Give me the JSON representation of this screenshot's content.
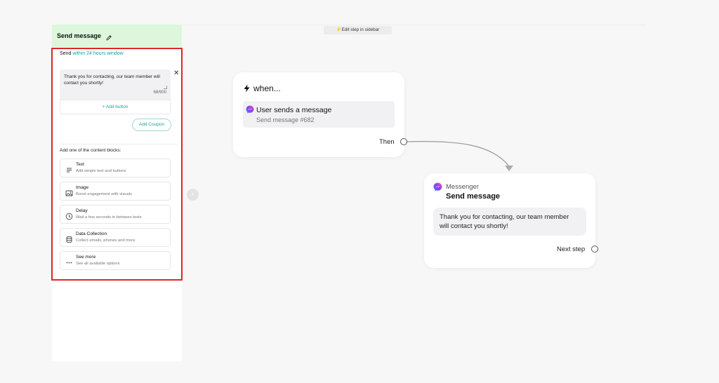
{
  "sidebar": {
    "title": "Send message",
    "send_prefix": "Send",
    "send_window": "within 24 hours window",
    "message_text": "Thank you for contacting, our team member  will contact you shortly!",
    "char_count": "68/900",
    "close_glyph": "✕",
    "add_button_label": "+ Add button",
    "coupon_label": "Add Coupon",
    "blocks_label": "Add one of the content blocks:",
    "blocks": [
      {
        "title": "Text",
        "subtitle": "Add simple text and buttons",
        "icon": "text-lines-icon"
      },
      {
        "title": "Image",
        "subtitle": "Boost engagement with visuals",
        "icon": "image-icon"
      },
      {
        "title": "Delay",
        "subtitle": "Wait a few seconds in between texts",
        "icon": "clock-icon"
      },
      {
        "title": "Data Collection",
        "subtitle": "Collect emails, phones and more",
        "icon": "database-icon"
      },
      {
        "title": "See more",
        "subtitle": "See all available options",
        "icon": "more-dots-icon"
      }
    ]
  },
  "hint": "⚡Edit step in sidebar",
  "collapse_glyph": "‹",
  "trigger_node": {
    "title": "when...",
    "event_title": "User sends a message",
    "event_subtitle": "Send message #682",
    "then_label": "Then"
  },
  "action_node": {
    "channel": "Messenger",
    "title": "Send message",
    "message": "Thank you for contacting, our team member will contact you shortly!",
    "next_label": "Next step"
  },
  "colors": {
    "accent": "#1aa39a",
    "header_green": "#dcf7dc",
    "highlight_red": "#e02424",
    "messenger_purple": "#8a3ffc"
  }
}
